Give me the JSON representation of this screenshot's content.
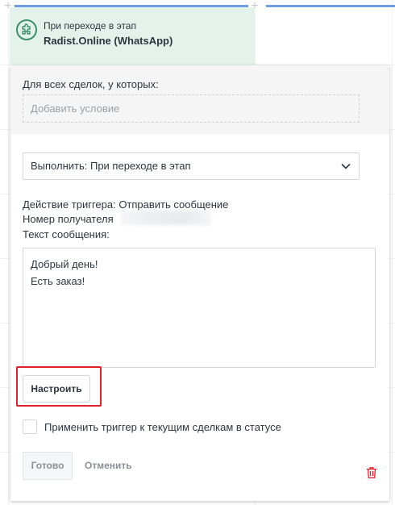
{
  "trigger": {
    "subtitle": "При переходе в этап",
    "title": "Radist.Online (WhatsApp)",
    "icon": "puzzle-icon"
  },
  "conditions": {
    "label": "Для всех сделок, у которых:",
    "placeholder": "Добавить условие"
  },
  "execute": {
    "selected": "Выполнить: При переходе в этап",
    "icon": "chevron-down-icon"
  },
  "details": {
    "action": "Действие триггера: Отправить сообщение",
    "recipient_label": "Номер получателя",
    "message_label": "Текст сообщения:"
  },
  "message": {
    "text": "Добрый день!\nЕсть заказ!"
  },
  "buttons": {
    "configure": "Настроить",
    "done": "Готово",
    "cancel": "Отменить"
  },
  "apply_checkbox": {
    "label": "Применить триггер к текущим сделкам в статусе",
    "checked": false
  },
  "colors": {
    "accent_bar": "#6f9de6",
    "header_bg": "#e3f3ec",
    "icon_green": "#3c8f72",
    "highlight_red": "#e0202a",
    "trash_red": "#e0202a"
  }
}
